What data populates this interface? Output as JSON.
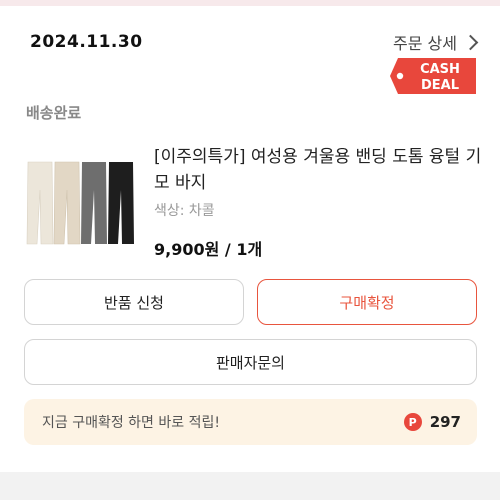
{
  "order": {
    "date": "2024.11.30",
    "detail_label": "주문 상세",
    "status": "배송완료"
  },
  "badge": {
    "line1": "CASH",
    "line2": "DEAL",
    "color": "#e8473c"
  },
  "product": {
    "title": "[이주의특가] 여성용 겨울용 밴딩 도톰 융털 기모 바지",
    "option": "색상: 차콜",
    "price": "9,900원 / 1개",
    "thumbnail_colors": [
      "#ece6da",
      "#e2d7c5",
      "#6e6e6e",
      "#1e1e1e"
    ]
  },
  "actions": {
    "return_label": "반품 신청",
    "confirm_label": "구매확정",
    "inquiry_label": "판매자문의"
  },
  "reward": {
    "message": "지금 구매확정 하면 바로 적립!",
    "icon_letter": "P",
    "points": "297"
  },
  "colors": {
    "accent": "#e8553e",
    "reward_bg": "#fdf3e4"
  }
}
